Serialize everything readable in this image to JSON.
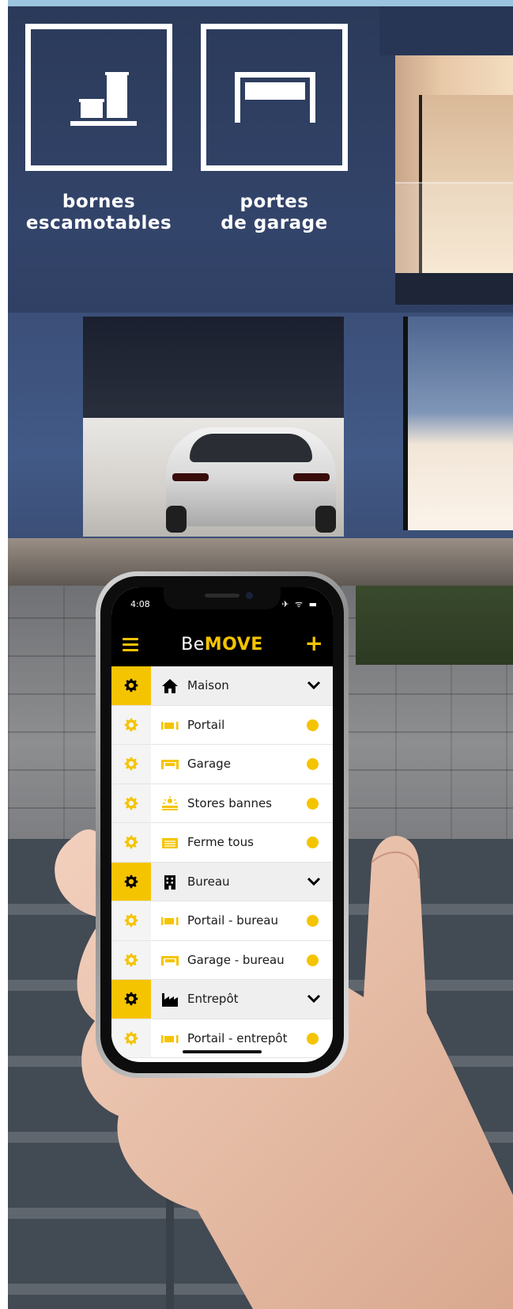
{
  "categories": [
    {
      "id": "bornes",
      "line1": "bornes",
      "line2": "escamotables",
      "icon": "bollards-icon"
    },
    {
      "id": "portes",
      "line1": "portes",
      "line2": "de garage",
      "icon": "garage-door-icon"
    }
  ],
  "phone": {
    "status_time": "4:08",
    "status_icons": "✈ ᯤ ▬",
    "app": {
      "brand_prefix": "Be",
      "brand_suffix": "MOVE",
      "menu_icon": "hamburger-menu-icon",
      "add_icon": "plus-icon",
      "add_label": "+"
    },
    "rows": [
      {
        "type": "group",
        "label": "Maison",
        "icon": "house-icon"
      },
      {
        "type": "device",
        "label": "Portail",
        "icon": "gate-icon"
      },
      {
        "type": "device",
        "label": "Garage",
        "icon": "garage-icon"
      },
      {
        "type": "device",
        "label": "Stores bannes",
        "icon": "awning-icon"
      },
      {
        "type": "device",
        "label": "Ferme tous",
        "icon": "close-all-icon"
      },
      {
        "type": "group",
        "label": "Bureau",
        "icon": "office-building-icon"
      },
      {
        "type": "device",
        "label": "Portail - bureau",
        "icon": "gate-icon"
      },
      {
        "type": "device",
        "label": "Garage - bureau",
        "icon": "garage-icon"
      },
      {
        "type": "group",
        "label": "Entrepôt",
        "icon": "factory-icon"
      },
      {
        "type": "device",
        "label": "Portail - entrepôt",
        "icon": "gate-icon"
      }
    ]
  },
  "colors": {
    "accent": "#f5c400",
    "facade": "#2e3d60",
    "app_bar": "#000000"
  }
}
